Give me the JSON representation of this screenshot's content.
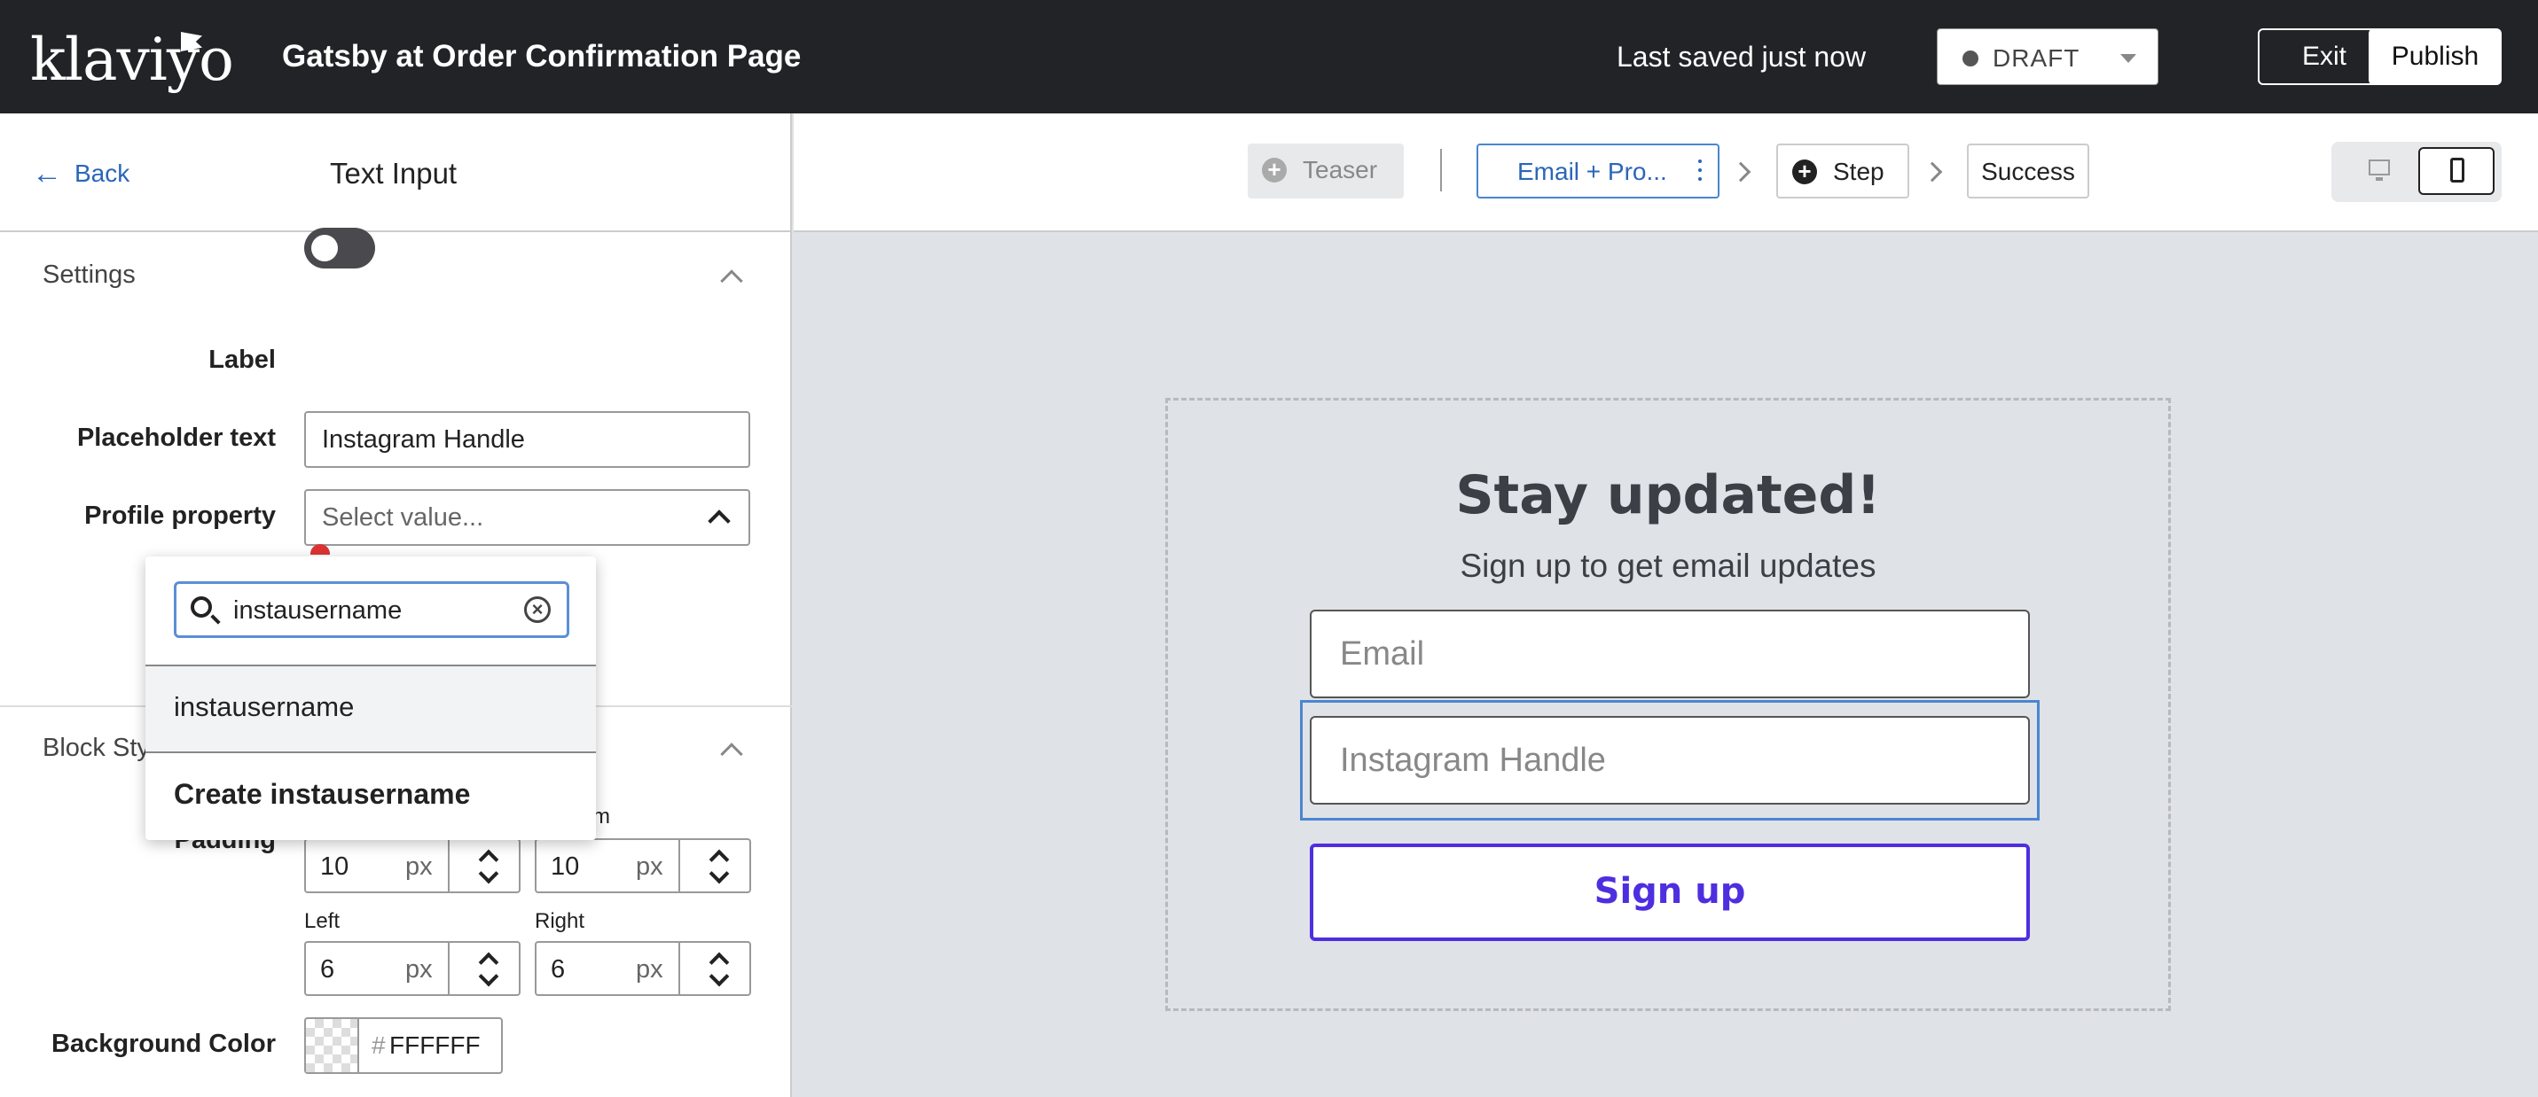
{
  "topbar": {
    "logo": "klaviyo",
    "title": "Gatsby at Order Confirmation Page",
    "saved_status": "Last saved just now",
    "status_value": "DRAFT",
    "exit_label": "Exit",
    "publish_label": "Publish"
  },
  "left_panel": {
    "back_label": "Back",
    "title": "Text Input",
    "settings": {
      "section_label": "Settings",
      "label_toggle_label": "Label",
      "placeholder_label": "Placeholder text",
      "placeholder_value": "Instagram Handle",
      "profile_property_label": "Profile property",
      "profile_property_placeholder": "Select value..."
    },
    "block_styles": {
      "section_label": "Block Sty",
      "padding_label": "Padding",
      "top_value": "10",
      "bottom_label_fragment": "m",
      "bottom_value": "10",
      "unit": "px",
      "left_label": "Left",
      "left_value": "6",
      "right_label": "Right",
      "right_value": "6",
      "background_color_label": "Background Color",
      "background_color_hash": "#",
      "background_color_value": "FFFFFF"
    }
  },
  "dropdown": {
    "search_value": "instausername",
    "option": "instausername",
    "create_label": "Create instausername"
  },
  "steps": {
    "teaser": "Teaser",
    "email": "Email + Pro...",
    "step": "Step",
    "success": "Success"
  },
  "form": {
    "heading": "Stay updated!",
    "subheading": "Sign up to get email updates",
    "email_placeholder": "Email",
    "instagram_placeholder": "Instagram Handle",
    "signup_label": "Sign up"
  },
  "colors": {
    "topbar_bg": "#222326",
    "accent_blue": "#2a66b8",
    "signup_purple": "#4f2ee0",
    "canvas_bg": "#dfe2e6"
  },
  "icons": [
    "back-arrow-icon",
    "chevron-up-icon",
    "chevron-down-icon",
    "search-icon",
    "clear-icon",
    "plus-circle-icon",
    "kebab-icon",
    "chevron-right-icon",
    "desktop-icon",
    "mobile-icon",
    "flag-icon"
  ]
}
